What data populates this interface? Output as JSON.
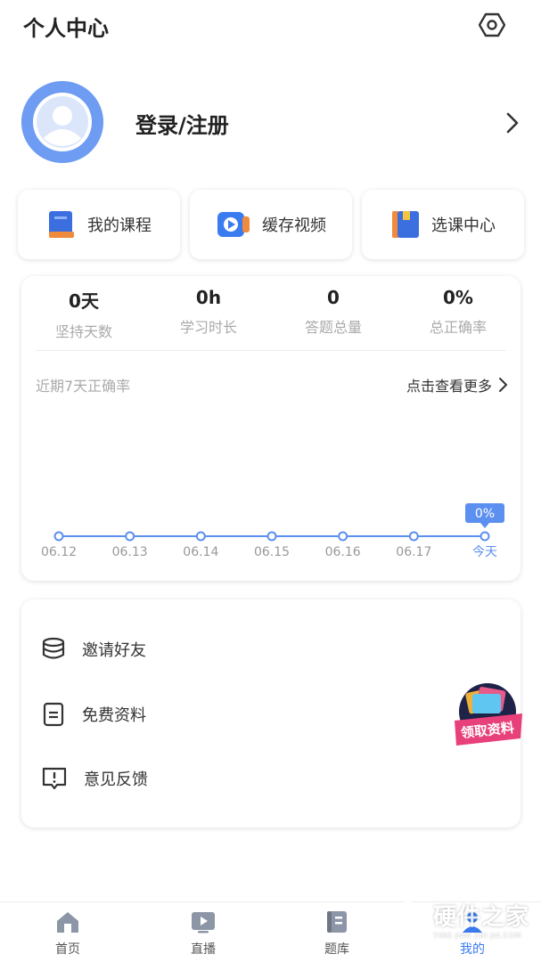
{
  "header": {
    "title": "个人中心",
    "settings_icon": "settings-hexagon-icon"
  },
  "profile": {
    "login_label": "登录/注册",
    "avatar_icon": "user-avatar-icon",
    "arrow_icon": "chevron-right-icon"
  },
  "quick_actions": [
    {
      "label": "我的课程",
      "icon": "book-icon"
    },
    {
      "label": "缓存视频",
      "icon": "video-play-icon"
    },
    {
      "label": "选课中心",
      "icon": "course-center-icon"
    }
  ],
  "stats": [
    {
      "value": "0天",
      "label": "坚持天数"
    },
    {
      "value": "0h",
      "label": "学习时长"
    },
    {
      "value": "0",
      "label": "答题总量"
    },
    {
      "value": "0%",
      "label": "总正确率"
    }
  ],
  "accuracy": {
    "title": "近期7天正确率",
    "more_label": "点击查看更多",
    "tooltip": "0%"
  },
  "chart_data": {
    "type": "line",
    "title": "近期7天正确率",
    "categories": [
      "06.12",
      "06.13",
      "06.14",
      "06.15",
      "06.16",
      "06.17",
      "今天"
    ],
    "values": [
      0,
      0,
      0,
      0,
      0,
      0,
      0
    ],
    "highlight_label": "0%",
    "color": "#5b8ff0"
  },
  "menu": [
    {
      "label": "邀请好友",
      "icon": "database-stack-icon"
    },
    {
      "label": "免费资料",
      "icon": "document-icon"
    },
    {
      "label": "意见反馈",
      "icon": "feedback-icon"
    }
  ],
  "promo": {
    "label": "领取资料"
  },
  "tabs": [
    {
      "label": "首页",
      "icon": "home-icon",
      "active": false
    },
    {
      "label": "直播",
      "icon": "live-play-icon",
      "active": false
    },
    {
      "label": "题库",
      "icon": "question-bank-icon",
      "active": false
    },
    {
      "label": "我的",
      "icon": "me-icon",
      "active": true
    }
  ],
  "watermark": {
    "text": "硬件之家",
    "sub": "YING JIAN ZHI JIA.COM"
  },
  "colors": {
    "accent": "#3a7bf0",
    "chart_line": "#5b8ff0",
    "avatar": "#6e9cf3"
  }
}
